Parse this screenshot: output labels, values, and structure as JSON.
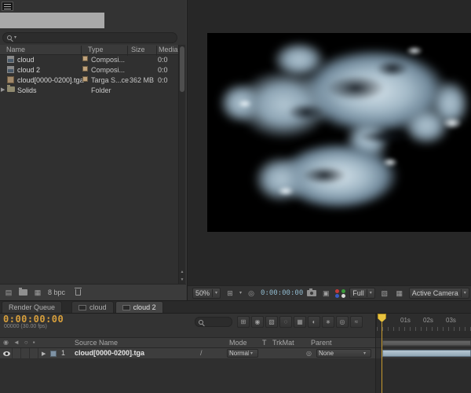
{
  "icons": {
    "dropdown": "▾",
    "twirl": "▶",
    "scroll_up": "▲",
    "scroll_down": "▼",
    "interpret_footage": "▤",
    "new_composition": "▦",
    "grid_guides": "⊞",
    "mask_visibility": "◎",
    "show_snapshot": "▣",
    "region_of_interest": "▧",
    "transparency_grid": "▦",
    "eye_column": "◉",
    "audio_column": "◄",
    "solo_column": "○",
    "lock_column": "▪",
    "quality_switch": "/",
    "pick_whip": "◎"
  },
  "project": {
    "header_columns": {
      "name": "Name",
      "type": "Type",
      "size": "Size",
      "media": "Media D"
    },
    "items": [
      {
        "name": "cloud",
        "type": "Composi...",
        "size": "",
        "media": "0:0"
      },
      {
        "name": "cloud 2",
        "type": "Composi...",
        "size": "",
        "media": "0:0"
      },
      {
        "name": "cloud[0000-0200].tga",
        "type": "Targa S...ce",
        "size": "362 MB",
        "media": "0:0"
      },
      {
        "name": "Solids",
        "type": "Folder",
        "size": "",
        "media": ""
      }
    ],
    "footer": {
      "bpc": "8 bpc"
    }
  },
  "viewer": {
    "zoom": "50%",
    "timecode": "0:00:00:00",
    "resolution": "Full",
    "view": "Active Camera"
  },
  "tabs": [
    {
      "label": "Render Queue",
      "active": false
    },
    {
      "label": "cloud",
      "active": false
    },
    {
      "label": "cloud 2",
      "active": true
    }
  ],
  "timeline": {
    "timecode": "0:00:00:00",
    "frame_info": "00000 (30.00 fps)",
    "toolbar_icons": [
      "⊞",
      "◉",
      "▧",
      "◌",
      "▦",
      "◐",
      "∗",
      "◎",
      "≈"
    ],
    "ruler_labels": [
      "01s",
      "02s",
      "03s"
    ],
    "columns": {
      "source_name": "Source Name",
      "mode": "Mode",
      "t": "T",
      "trkmat": "TrkMat",
      "parent": "Parent"
    },
    "layer": {
      "index": "1",
      "name": "cloud[0000-0200].tga",
      "mode": "Normal",
      "parent": "None"
    }
  },
  "colors": {
    "timecode_orange": "#d79f3c",
    "viewer_timecode_blue": "#8fb8cc",
    "cti_gold": "#e8c33f",
    "layer_bar_blue": "#9fb4c2"
  }
}
